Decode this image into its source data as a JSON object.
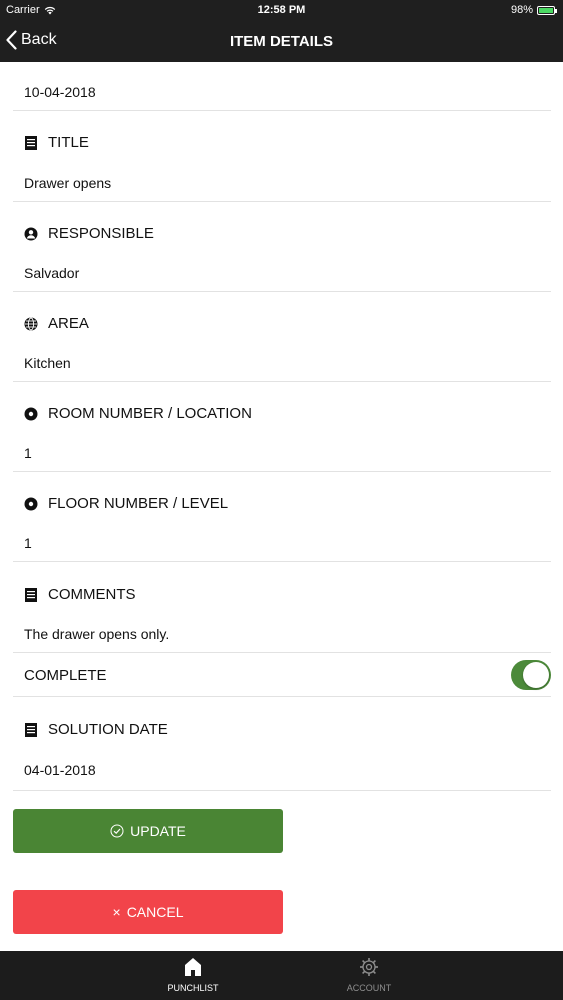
{
  "status_bar": {
    "carrier": "Carrier",
    "time": "12:58 PM",
    "battery": "98%",
    "battery_level": 0.98
  },
  "nav": {
    "back_label": "Back",
    "title": "ITEM DETAILS"
  },
  "date": "10-04-2018",
  "fields": {
    "title": {
      "label": "TITLE",
      "value": "Drawer opens",
      "icon": "list-icon"
    },
    "responsible": {
      "label": "RESPONSIBLE",
      "value": "Salvador",
      "icon": "person-icon"
    },
    "area": {
      "label": "AREA",
      "value": "Kitchen",
      "icon": "globe-icon"
    },
    "room": {
      "label": "ROOM NUMBER / LOCATION",
      "value": "1",
      "icon": "location-icon"
    },
    "floor": {
      "label": "FLOOR NUMBER / LEVEL",
      "value": "1",
      "icon": "location-icon"
    },
    "comments": {
      "label": "COMMENTS",
      "value": "The drawer opens only.",
      "icon": "list-icon"
    },
    "solution_date": {
      "label": "SOLUTION DATE",
      "value": "04-01-2018",
      "icon": "list-icon"
    }
  },
  "complete": {
    "label": "COMPLETE",
    "on": true
  },
  "buttons": {
    "update_label": "UPDATE",
    "cancel_label": "CANCEL"
  },
  "tabs": [
    {
      "label": "PUNCHLIST",
      "active": true,
      "icon": "home-icon"
    },
    {
      "label": "ACCOUNT",
      "active": false,
      "icon": "gear-icon"
    }
  ],
  "colors": {
    "accent_green": "#4a8534",
    "cancel_red": "#f2444a",
    "bar_dark": "#1f1f1f",
    "active_tab": "#ffffff",
    "inactive_tab": "#8e8e8e"
  }
}
